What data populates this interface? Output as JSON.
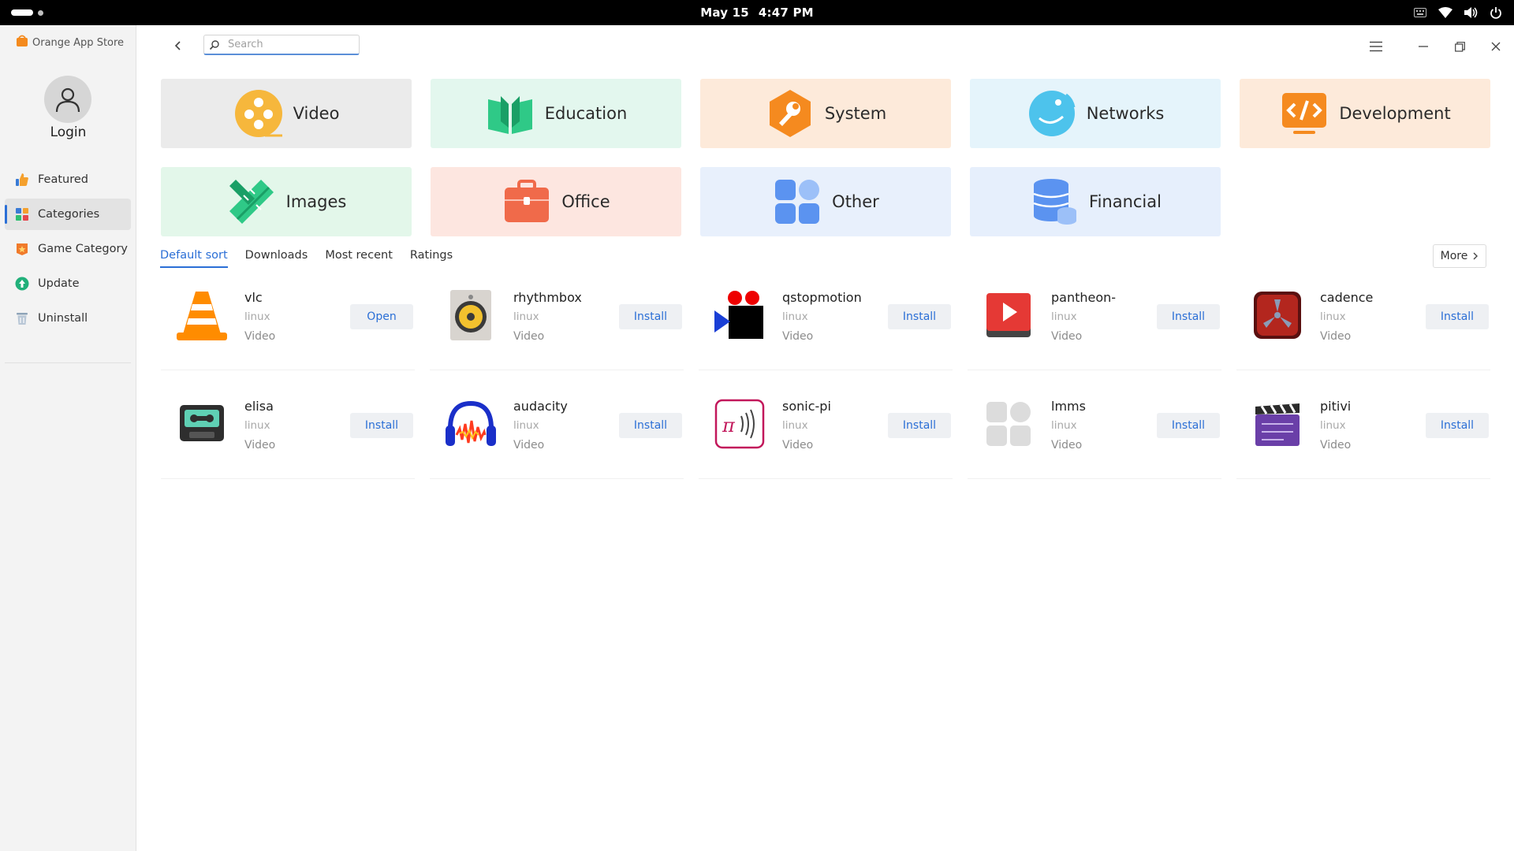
{
  "system_bar": {
    "date": "May 15",
    "time": "4:47 PM"
  },
  "app": {
    "title": "Orange App Store"
  },
  "sidebar": {
    "login_label": "Login",
    "items": [
      {
        "label": "Featured",
        "icon": "thumbs-up-icon"
      },
      {
        "label": "Categories",
        "icon": "grid-icon",
        "active": true
      },
      {
        "label": "Game Category",
        "icon": "game-star-icon"
      },
      {
        "label": "Update",
        "icon": "update-arrow-icon"
      },
      {
        "label": "Uninstall",
        "icon": "trash-icon"
      }
    ]
  },
  "search": {
    "placeholder": "Search",
    "value": ""
  },
  "categories": [
    {
      "label": "Video",
      "bg": "#ebebeb"
    },
    {
      "label": "Education",
      "bg": "#e3f7ee"
    },
    {
      "label": "System",
      "bg": "#fdeada"
    },
    {
      "label": "Networks",
      "bg": "#e5f4fb"
    },
    {
      "label": "Development",
      "bg": "#fdeada"
    },
    {
      "label": "Images",
      "bg": "#e3f7ea"
    },
    {
      "label": "Office",
      "bg": "#fde6e0"
    },
    {
      "label": "Other",
      "bg": "#e8f0fc"
    },
    {
      "label": "Financial",
      "bg": "#e6effc"
    }
  ],
  "sort_tabs": [
    {
      "label": "Default sort",
      "active": true
    },
    {
      "label": "Downloads"
    },
    {
      "label": "Most recent"
    },
    {
      "label": "Ratings"
    }
  ],
  "more_label": "More",
  "apps": [
    {
      "name": "vlc",
      "os": "linux",
      "category": "Video",
      "action": "Open",
      "icon": "vlc-cone-icon"
    },
    {
      "name": "rhythmbox",
      "os": "linux",
      "category": "Video",
      "action": "Install",
      "icon": "speaker-icon"
    },
    {
      "name": "qstopmotion",
      "os": "linux",
      "category": "Video",
      "action": "Install",
      "icon": "camera-icon"
    },
    {
      "name": "pantheon-",
      "os": "linux",
      "category": "Video",
      "action": "Install",
      "icon": "play-icon"
    },
    {
      "name": "cadence",
      "os": "linux",
      "category": "Video",
      "action": "Install",
      "icon": "cadence-icon"
    },
    {
      "name": "elisa",
      "os": "linux",
      "category": "Video",
      "action": "Install",
      "icon": "cassette-icon"
    },
    {
      "name": "audacity",
      "os": "linux",
      "category": "Video",
      "action": "Install",
      "icon": "headphones-icon"
    },
    {
      "name": "sonic-pi",
      "os": "linux",
      "category": "Video",
      "action": "Install",
      "icon": "sonic-pi-icon"
    },
    {
      "name": "lmms",
      "os": "linux",
      "category": "Video",
      "action": "Install",
      "icon": "placeholder-grid-icon"
    },
    {
      "name": "pitivi",
      "os": "linux",
      "category": "Video",
      "action": "Install",
      "icon": "clapperboard-icon"
    }
  ]
}
